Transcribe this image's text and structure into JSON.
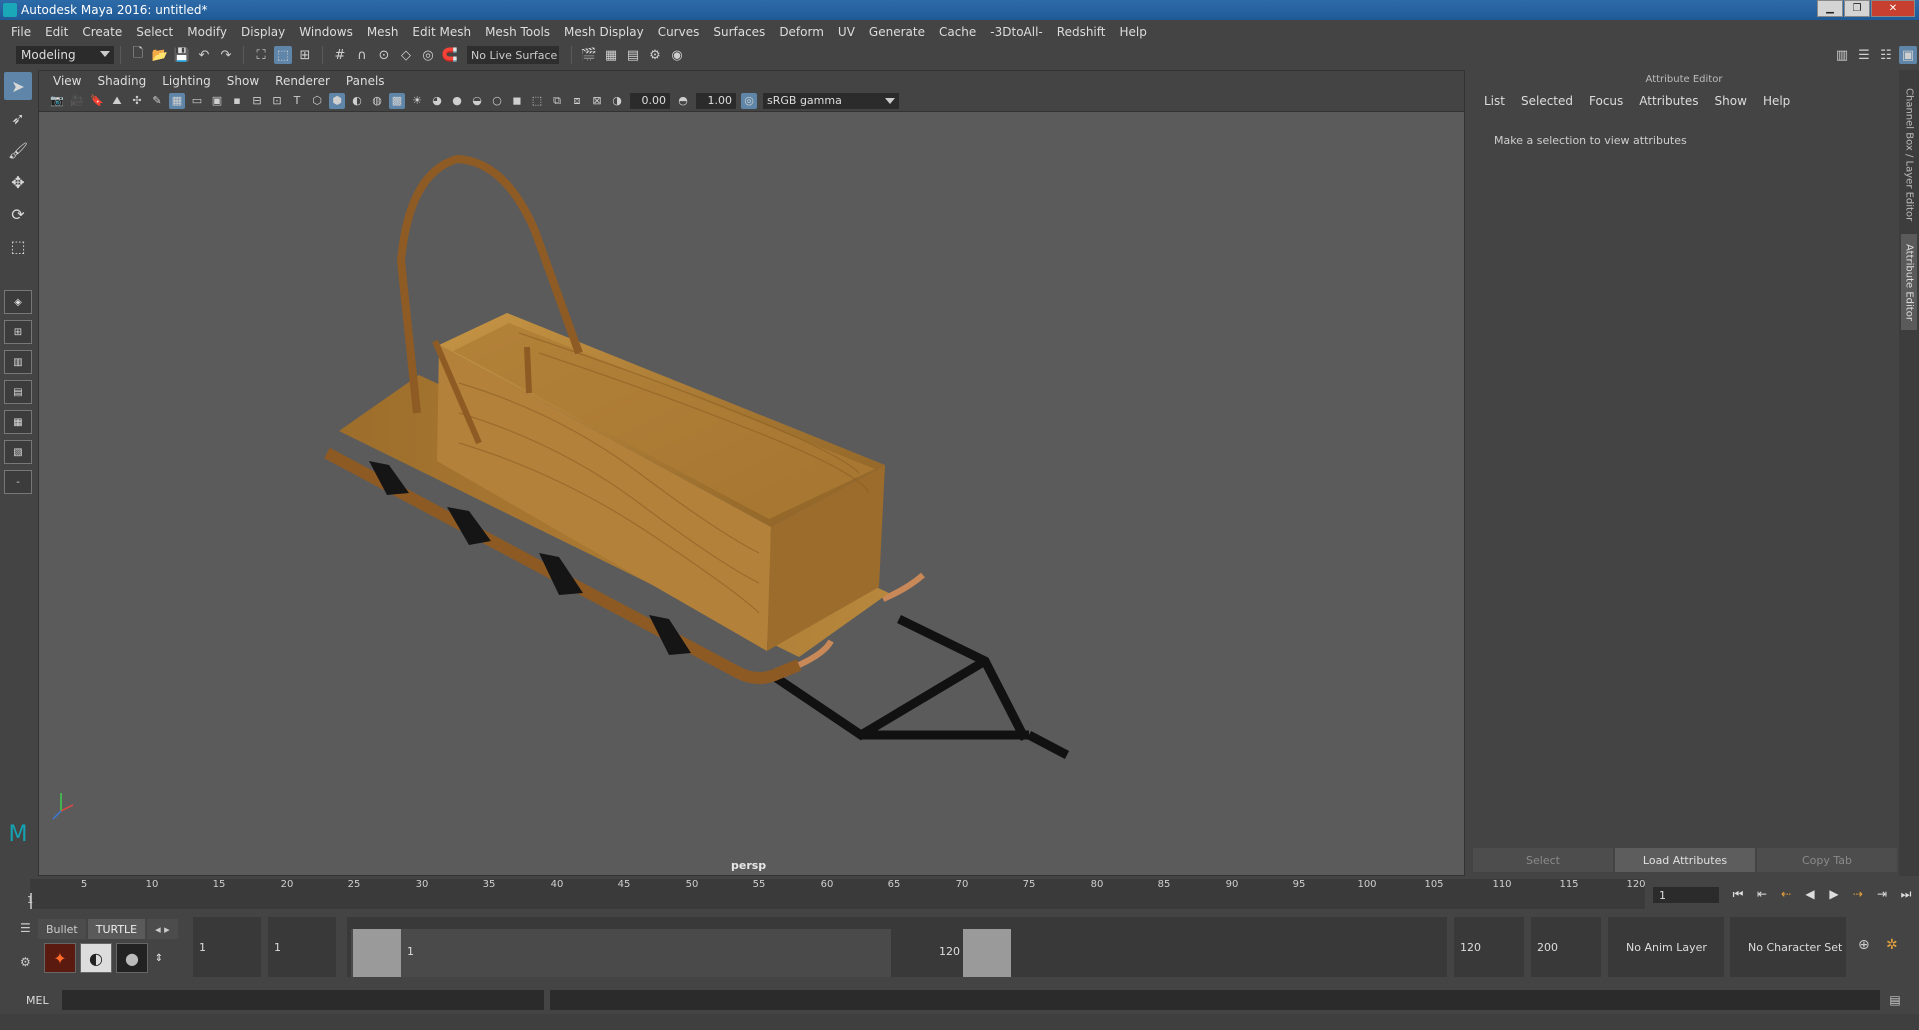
{
  "window": {
    "title": "Autodesk Maya 2016: untitled*"
  },
  "menubar": [
    "File",
    "Edit",
    "Create",
    "Select",
    "Modify",
    "Display",
    "Windows",
    "Mesh",
    "Edit Mesh",
    "Mesh Tools",
    "Mesh Display",
    "Curves",
    "Surfaces",
    "Deform",
    "UV",
    "Generate",
    "Cache",
    "-3DtoAll-",
    "Redshift",
    "Help"
  ],
  "statusline": {
    "mode": "Modeling",
    "live_surface": "No Live Surface"
  },
  "viewport": {
    "menu": [
      "View",
      "Shading",
      "Lighting",
      "Show",
      "Renderer",
      "Panels"
    ],
    "exposure": "0.00",
    "gamma": "1.00",
    "color_space": "sRGB gamma",
    "camera": "persp"
  },
  "attribute_editor": {
    "title": "Attribute Editor",
    "menu": [
      "List",
      "Selected",
      "Focus",
      "Attributes",
      "Show",
      "Help"
    ],
    "hint": "Make a selection to view attributes",
    "buttons": {
      "select": "Select",
      "load": "Load Attributes",
      "copy": "Copy Tab"
    }
  },
  "side_tabs": {
    "channel_box": "Channel Box / Layer Editor",
    "attribute_editor": "Attribute Editor"
  },
  "timeline": {
    "ticks": [
      "5",
      "10",
      "15",
      "20",
      "25",
      "30",
      "35",
      "40",
      "45",
      "50",
      "55",
      "60",
      "65",
      "70",
      "75",
      "80",
      "85",
      "90",
      "95",
      "100",
      "105",
      "110",
      "115",
      "120"
    ],
    "start_marker": "1",
    "current_frame": "1"
  },
  "shelf": {
    "tabs": [
      "Bullet",
      "TURTLE"
    ]
  },
  "range": {
    "start": "1",
    "anim_start": "1",
    "range_start_label": "1",
    "range_end_label": "120",
    "anim_end": "120",
    "end": "200",
    "anim_layer": "No Anim Layer",
    "character_set": "No Character Set"
  },
  "mel": {
    "label": "MEL"
  }
}
